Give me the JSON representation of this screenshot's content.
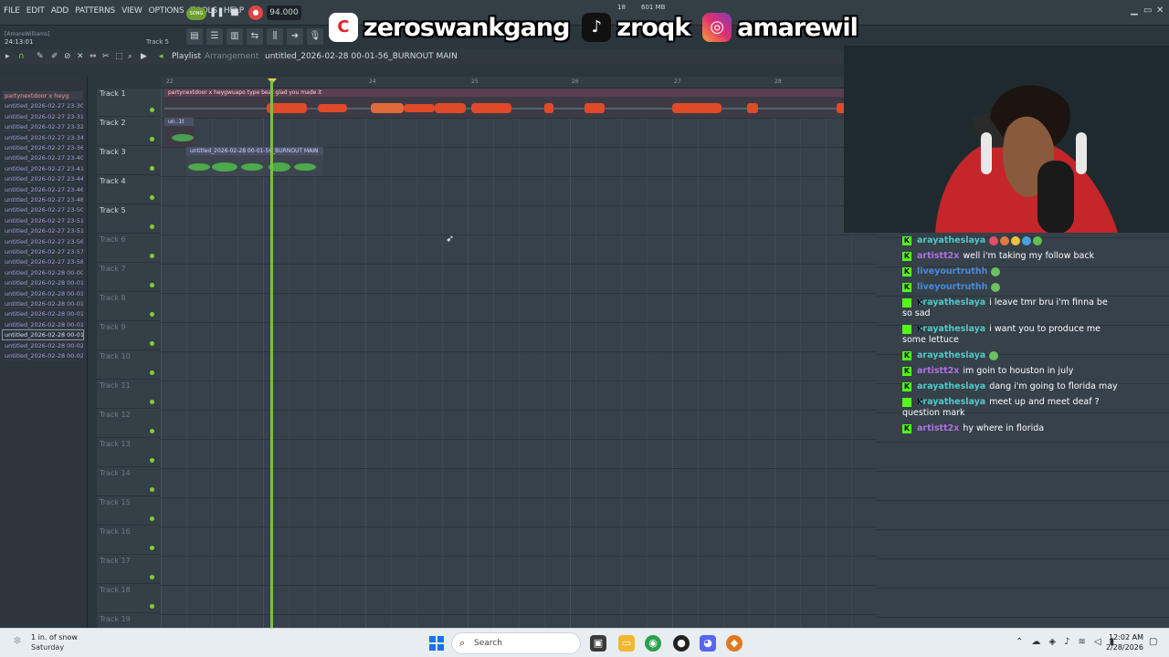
{
  "menu": [
    "FILE",
    "EDIT",
    "ADD",
    "PATTERNS",
    "VIEW",
    "OPTIONS",
    "TOOLS",
    "HELP"
  ],
  "transport": {
    "mode": "SONG",
    "tempo": "94.000",
    "time": "0:56",
    "time_unit": "M:S:CS",
    "time_sub": "30"
  },
  "cpu": {
    "cores": "18",
    "memory": "601 MB"
  },
  "hint": {
    "user": "[AmareWilliams]",
    "time": "24:13:01",
    "track": "Track 5"
  },
  "overlay": {
    "capcut": "zeroswankgang",
    "tiktok": "zroqk",
    "instagram": "amarewil"
  },
  "playlist": {
    "title": "Playlist",
    "subtitle": "Arrangement",
    "song": "untitled_2026-02-28 00-01-56_BURNOUT MAIN"
  },
  "patterns": [
    "partynextdoor x heyg",
    "untitled_2026-02-27 23-30",
    "untitled_2026-02-27 23-31",
    "untitled_2026-02-27 23-32",
    "untitled_2026-02-27 23-34",
    "untitled_2026-02-27 23-36",
    "untitled_2026-02-27 23-40",
    "untitled_2026-02-27 23-41",
    "untitled_2026-02-27 23-44",
    "untitled_2026-02-27 23-46",
    "untitled_2026-02-27 23-48",
    "untitled_2026-02-27 23-50",
    "untitled_2026-02-27 23-51",
    "untitled_2026-02-27 23-51",
    "untitled_2026-02-27 23-56",
    "untitled_2026-02-27 23-57",
    "untitled_2026-02-27 23-58",
    "untitled_2026-02-28 00-00",
    "untitled_2026-02-28 00-01",
    "untitled_2026-02-28 00-01",
    "untitled_2026-02-28 00-01",
    "untitled_2026-02-28 00-01",
    "untitled_2026-02-28 00-01",
    "untitled_2026-02-28 00-01",
    "untitled_2026-02-28 00-02",
    "untitled_2026-02-28 00-02"
  ],
  "tracks": [
    "Track 1",
    "Track 2",
    "Track 3",
    "Track 4",
    "Track 5",
    "Track 6",
    "Track 7",
    "Track 8",
    "Track 9",
    "Track 10",
    "Track 11",
    "Track 12",
    "Track 13",
    "Track 14",
    "Track 15",
    "Track 16",
    "Track 17",
    "Track 18",
    "Track 19"
  ],
  "ruler": [
    "22",
    "24",
    "25",
    "26",
    "27",
    "28"
  ],
  "clips": {
    "track1": "partynextdoor x heygwuapo type beat glad you made it",
    "track2": "un..1t",
    "track3": "untitled_2026-02-28 00-01-56_BURNOUT MAIN"
  },
  "chat": [
    {
      "user": "arayatheslaya",
      "color": "#53c8c8",
      "text": "",
      "emotes": true
    },
    {
      "user": "artistt2x",
      "color": "#b070e0",
      "text": "well i'm taking my follow back"
    },
    {
      "user": "liveyourtruthh",
      "color": "#4a8ae0",
      "text": ""
    },
    {
      "user": "liveyourtruthh",
      "color": "#4a8ae0",
      "text": ""
    },
    {
      "user": "arayatheslaya",
      "color": "#53c8c8",
      "text": "i leave tmr bru i'm finna be so sad"
    },
    {
      "user": "arayatheslaya",
      "color": "#53c8c8",
      "text": "i want you to produce me some lettuce"
    },
    {
      "user": "arayatheslaya",
      "color": "#53c8c8",
      "text": ""
    },
    {
      "user": "artistt2x",
      "color": "#b070e0",
      "text": "im goin to houston in july"
    },
    {
      "user": "arayatheslaya",
      "color": "#53c8c8",
      "text": "dang i'm going to florida may"
    },
    {
      "user": "arayatheslaya",
      "color": "#53c8c8",
      "text": "meet up and meet deaf ? question mark"
    },
    {
      "user": "artistt2x",
      "color": "#b070e0",
      "text": "hy where in florida"
    }
  ],
  "taskbar": {
    "weather_temp": "1 in. of snow",
    "weather_day": "Saturday",
    "search": "Search",
    "time": "12:02 AM",
    "date": "2/28/2026"
  }
}
